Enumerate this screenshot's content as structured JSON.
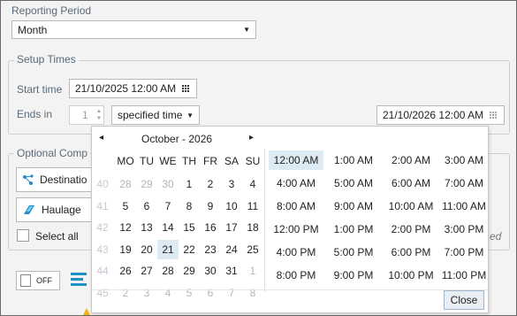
{
  "reporting": {
    "label": "Reporting Period",
    "value": "Month"
  },
  "setup": {
    "legend": "Setup Times",
    "start_label": "Start time",
    "start_value": "21/10/2025 12:00 AM",
    "ends_label": "Ends in",
    "ends_count": "1",
    "ends_mode": "specified time",
    "end_value": "21/10/2026 12:00 AM"
  },
  "optional": {
    "legend": "Optional Comp",
    "destination_label": "Destinatio",
    "haulage_label": "Haulage",
    "select_all_label": "Select all",
    "ed_fragment": "ed"
  },
  "bottom": {
    "toggle_label": "OFF"
  },
  "calendar": {
    "month_title": "October - 2026",
    "prev": "◂",
    "next": "▸",
    "day_headers": [
      "MO",
      "TU",
      "WE",
      "TH",
      "FR",
      "SA",
      "SU"
    ],
    "weeks": [
      {
        "week": "40",
        "days": [
          {
            "d": "28",
            "o": true
          },
          {
            "d": "29",
            "o": true
          },
          {
            "d": "30",
            "o": true
          },
          {
            "d": "1"
          },
          {
            "d": "2"
          },
          {
            "d": "3"
          },
          {
            "d": "4"
          }
        ]
      },
      {
        "week": "41",
        "days": [
          {
            "d": "5"
          },
          {
            "d": "6"
          },
          {
            "d": "7"
          },
          {
            "d": "8"
          },
          {
            "d": "9"
          },
          {
            "d": "10"
          },
          {
            "d": "11"
          }
        ]
      },
      {
        "week": "42",
        "days": [
          {
            "d": "12"
          },
          {
            "d": "13"
          },
          {
            "d": "14"
          },
          {
            "d": "15"
          },
          {
            "d": "16"
          },
          {
            "d": "17"
          },
          {
            "d": "18"
          }
        ]
      },
      {
        "week": "43",
        "days": [
          {
            "d": "19"
          },
          {
            "d": "20"
          },
          {
            "d": "21",
            "s": true
          },
          {
            "d": "22"
          },
          {
            "d": "23"
          },
          {
            "d": "24"
          },
          {
            "d": "25"
          }
        ]
      },
      {
        "week": "44",
        "days": [
          {
            "d": "26"
          },
          {
            "d": "27"
          },
          {
            "d": "28"
          },
          {
            "d": "29"
          },
          {
            "d": "30"
          },
          {
            "d": "31"
          },
          {
            "d": "1",
            "o": true
          }
        ]
      },
      {
        "week": "45",
        "days": [
          {
            "d": "2",
            "o": true
          },
          {
            "d": "3",
            "o": true
          },
          {
            "d": "4",
            "o": true
          },
          {
            "d": "5",
            "o": true
          },
          {
            "d": "6",
            "o": true
          },
          {
            "d": "7",
            "o": true
          },
          {
            "d": "8",
            "o": true
          }
        ]
      }
    ]
  },
  "times": {
    "rows": [
      [
        "12:00 AM",
        "1:00 AM",
        "2:00 AM",
        "3:00 AM"
      ],
      [
        "4:00 AM",
        "5:00 AM",
        "6:00 AM",
        "7:00 AM"
      ],
      [
        "8:00 AM",
        "9:00 AM",
        "10:00 AM",
        "11:00 AM"
      ],
      [
        "12:00 PM",
        "1:00 PM",
        "2:00 PM",
        "3:00 PM"
      ],
      [
        "4:00 PM",
        "5:00 PM",
        "6:00 PM",
        "7:00 PM"
      ],
      [
        "8:00 PM",
        "9:00 PM",
        "10:00 PM",
        "11:00 PM"
      ]
    ],
    "selected": "12:00 AM"
  },
  "close_label": "Close",
  "colors": {
    "selection": "#dcebf3",
    "label": "#5a6a7a",
    "accent": "#1f8fc8"
  }
}
